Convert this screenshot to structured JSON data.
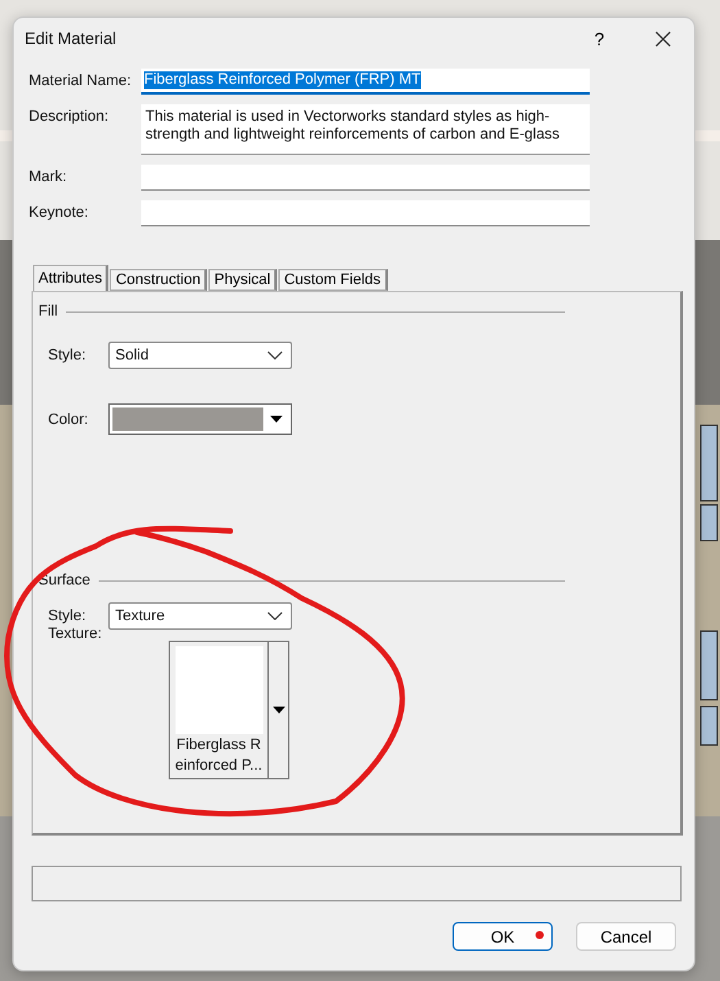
{
  "window": {
    "title": "Edit Material",
    "help": "?"
  },
  "fields": [
    {
      "kind": "line",
      "label": "Material Name:",
      "value_lines": [
        "Fiberglass Reinforced Polymer (FRP) MT"
      ],
      "text_selected": true
    },
    {
      "kind": "memo",
      "label": "Description:",
      "value_lines": [
        "This material is used in Vectorworks standard styles as high-",
        "strength and lightweight reinforcements of carbon and E-glass"
      ],
      "text_selected": false
    },
    {
      "kind": "line",
      "label": "Mark:",
      "text_selected": false
    },
    {
      "kind": "line",
      "label": "Keynote:",
      "text_selected": false
    }
  ],
  "tabs": [
    {
      "label": "Attributes",
      "selected": true
    },
    {
      "label": "Construction",
      "selected": false
    },
    {
      "label": "Physical",
      "selected": false
    },
    {
      "label": "Custom Fields",
      "selected": false
    }
  ],
  "fill": {
    "title": "Fill",
    "style": {
      "label": "Style:",
      "value": "Solid"
    },
    "color": {
      "label": "Color:",
      "color": "#9a9793"
    }
  },
  "surface": {
    "title": "Surface",
    "style": {
      "label": "Style:",
      "value": "Texture"
    },
    "texture": {
      "label": "Texture:",
      "name_lines": [
        "Fiberglass R",
        "einforced P..."
      ]
    }
  },
  "buttons": [
    {
      "label": "OK",
      "default": true
    },
    {
      "label": "Cancel",
      "default": false
    }
  ]
}
